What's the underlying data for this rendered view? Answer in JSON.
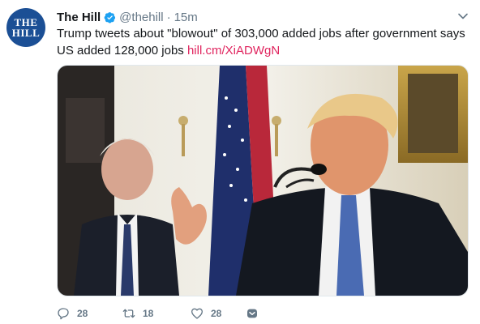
{
  "tweet": {
    "avatar_text_line1": "THE",
    "avatar_text_line2": "HILL",
    "display_name": "The Hill",
    "handle": "@thehill",
    "separator": "·",
    "time": "15m",
    "text": "Trump tweets about \"blowout\" of 303,000 added jobs after government says US added 128,000 jobs",
    "link_text": "hill.cm/XiADWgN",
    "media_alt": "",
    "actions": {
      "reply_count": "28",
      "retweet_count": "18",
      "like_count": "28"
    },
    "icons": {
      "verified": "verified-badge-icon",
      "caret": "chevron-down-icon",
      "reply": "reply-icon",
      "retweet": "retweet-icon",
      "like": "heart-icon",
      "dm": "direct-message-icon"
    },
    "colors": {
      "link": "#e0245e",
      "verified": "#1da1f2",
      "muted": "#657786",
      "avatar_bg": "#1b4f95"
    }
  }
}
